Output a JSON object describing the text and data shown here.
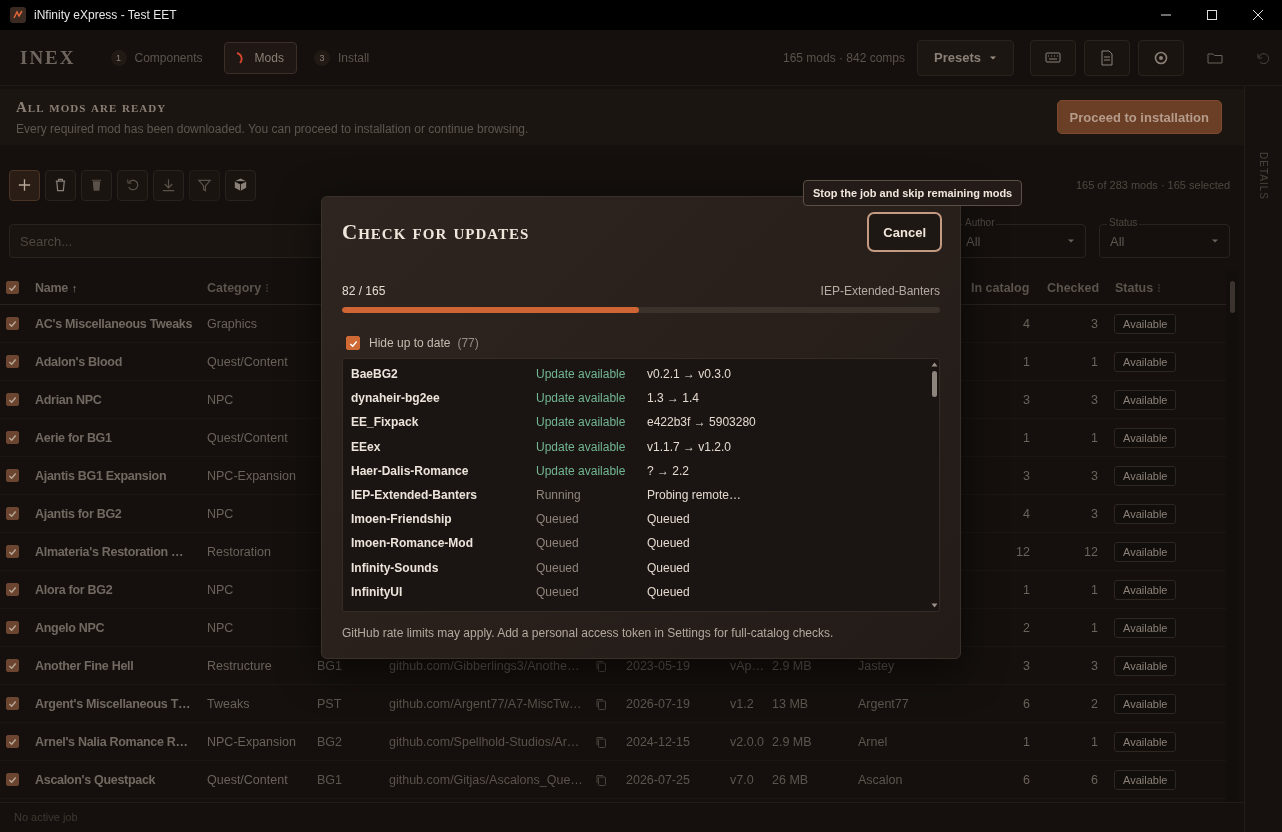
{
  "window": {
    "title": "iNfinity eXpress - Test EET"
  },
  "header": {
    "logo": "INEX",
    "steps": [
      {
        "number": "1",
        "label": "Components",
        "selected": false
      },
      {
        "label": "Mods",
        "selected": true
      },
      {
        "number": "3",
        "label": "Install",
        "selected": false
      }
    ],
    "stats": "165 mods · 842 comps",
    "presets": "Presets"
  },
  "banner": {
    "title": "All mods are ready",
    "message": "Every required mod has been downloaded. You can proceed to installation or continue browsing.",
    "button": "Proceed to installation"
  },
  "side_tab": "DETAILS",
  "selection_summary": "165 of 283 mods · 165 selected",
  "filters": {
    "search": {
      "placeholder": "Search..."
    },
    "author": {
      "label": "Author",
      "value": "All"
    },
    "status": {
      "label": "Status",
      "value": "All"
    }
  },
  "table": {
    "all_checked": true,
    "columns": [
      {
        "label": "Name",
        "sort_indicator": "↑"
      },
      {
        "label": "Category"
      },
      {
        "label": "In catalog"
      },
      {
        "label": "Checked"
      },
      {
        "label": "Status"
      }
    ],
    "rows": [
      {
        "checked": true,
        "name": "AC's Miscellaneous Tweaks",
        "category": "Graphics",
        "in_catalog": "4",
        "checked_count": "3",
        "status": "Available"
      },
      {
        "checked": true,
        "name": "Adalon's Blood",
        "category": "Quest/Content",
        "in_catalog": "1",
        "checked_count": "1",
        "status": "Available"
      },
      {
        "checked": true,
        "name": "Adrian NPC",
        "category": "NPC",
        "in_catalog": "3",
        "checked_count": "3",
        "status": "Available"
      },
      {
        "checked": true,
        "name": "Aerie for BG1",
        "category": "Quest/Content",
        "in_catalog": "1",
        "checked_count": "1",
        "status": "Available"
      },
      {
        "checked": true,
        "name": "Ajantis BG1 Expansion",
        "category": "NPC-Expansion",
        "in_catalog": "3",
        "checked_count": "3",
        "status": "Available"
      },
      {
        "checked": true,
        "name": "Ajantis for BG2",
        "category": "NPC",
        "in_catalog": "4",
        "checked_count": "3",
        "status": "Available"
      },
      {
        "checked": true,
        "name": "Almateria's Restoration …",
        "category": "Restoration",
        "in_catalog": "12",
        "checked_count": "12",
        "status": "Available"
      },
      {
        "checked": true,
        "name": "Alora for BG2",
        "category": "NPC",
        "in_catalog": "1",
        "checked_count": "1",
        "status": "Available"
      },
      {
        "checked": true,
        "name": "Angelo NPC",
        "category": "NPC",
        "in_catalog": "2",
        "checked_count": "1",
        "status": "Available"
      },
      {
        "checked": true,
        "name": "Another Fine Hell",
        "category": "Restructure",
        "game": "BG1",
        "source": "github.com/Gibberlings3/Anothe…",
        "date": "2023-05-19",
        "version": "vAp…",
        "size": "2.9 MB",
        "author": "Jastey",
        "in_catalog": "3",
        "checked_count": "3",
        "status": "Available"
      },
      {
        "checked": true,
        "name": "Argent's Miscellaneous T…",
        "category": "Tweaks",
        "game": "PST",
        "source": "github.com/Argent77/A7-MiscTw…",
        "date": "2026-07-19",
        "version": "v1.2",
        "size": "13 MB",
        "author": "Argent77",
        "in_catalog": "6",
        "checked_count": "2",
        "status": "Available"
      },
      {
        "checked": true,
        "name": "Arnel's Nalia Romance R…",
        "category": "NPC-Expansion",
        "game": "BG2",
        "source": "github.com/Spellhold-Studios/Ar…",
        "date": "2024-12-15",
        "version": "v2.0.0",
        "size": "2.9 MB",
        "author": "Arnel",
        "in_catalog": "1",
        "checked_count": "1",
        "status": "Available"
      },
      {
        "checked": true,
        "name": "Ascalon's Questpack",
        "category": "Quest/Content",
        "game": "BG1",
        "source": "github.com/Gitjas/Ascalons_Que…",
        "date": "2026-07-25",
        "version": "v7.0",
        "size": "26 MB",
        "author": "Ascalon",
        "in_catalog": "6",
        "checked_count": "6",
        "status": "Available"
      }
    ]
  },
  "status_bar": "No active job",
  "dialog": {
    "title": "Check for updates",
    "cancel": "Cancel",
    "tooltip": "Stop the job and skip remaining mods",
    "progress": {
      "count": "82 / 165",
      "current": "IEP-Extended-Banters",
      "level": 0.497
    },
    "hide_up_to_date": {
      "label": "Hide up to date",
      "count": "(77)",
      "checked": true
    },
    "results": [
      {
        "name": "BaeBG2",
        "kind": "update",
        "status": "Update available",
        "detail": "v0.2.1 → v0.3.0"
      },
      {
        "name": "dynaheir-bg2ee",
        "kind": "update",
        "status": "Update available",
        "detail": "1.3 → 1.4"
      },
      {
        "name": "EE_Fixpack",
        "kind": "update",
        "status": "Update available",
        "detail": "e422b3f → 5903280"
      },
      {
        "name": "EEex",
        "kind": "update",
        "status": "Update available",
        "detail": "v1.1.7 → v1.2.0"
      },
      {
        "name": "Haer-Dalis-Romance",
        "kind": "update",
        "status": "Update available",
        "detail": "? → 2.2"
      },
      {
        "name": "IEP-Extended-Banters",
        "kind": "running",
        "status": "Running",
        "detail": "Probing remote…"
      },
      {
        "name": "Imoen-Friendship",
        "kind": "queued",
        "status": "Queued",
        "detail": "Queued"
      },
      {
        "name": "Imoen-Romance-Mod",
        "kind": "queued",
        "status": "Queued",
        "detail": "Queued"
      },
      {
        "name": "Infinity-Sounds",
        "kind": "queued",
        "status": "Queued",
        "detail": "Queued"
      },
      {
        "name": "InfinityUI",
        "kind": "queued",
        "status": "Queued",
        "detail": "Queued"
      }
    ],
    "note": "GitHub rate limits may apply. Add a personal access token in Settings for full-catalog checks."
  }
}
